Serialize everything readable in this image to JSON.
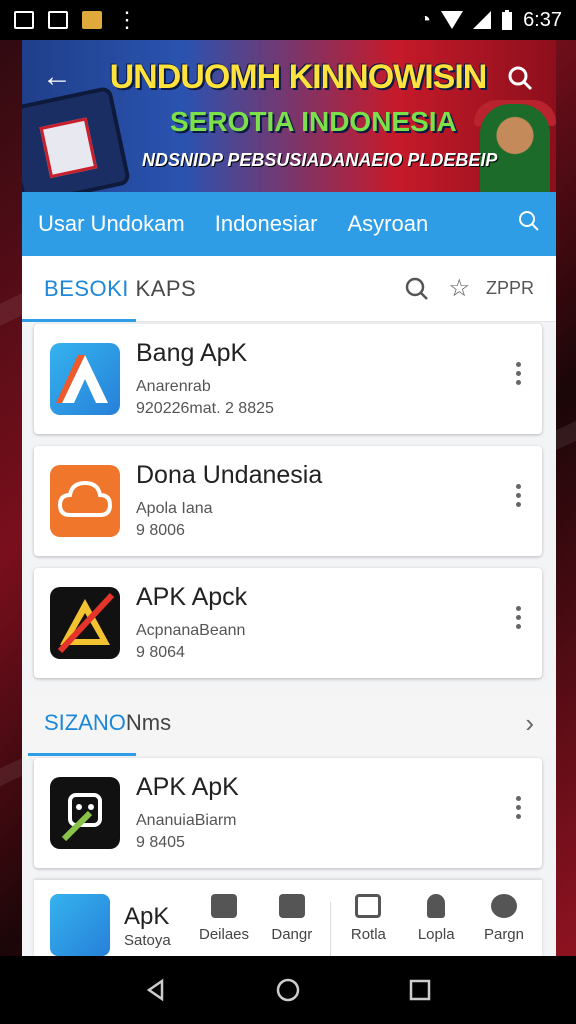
{
  "status_bar": {
    "time": "6:37",
    "icons": [
      "photo-icon",
      "gallery-icon",
      "app-icon",
      "more-vert-icon",
      "alarm-icon",
      "wifi-icon",
      "signal-icon",
      "battery-icon"
    ]
  },
  "banner": {
    "line1": "UNDUOMH KINNOWISIN",
    "line2": "SEROTIA INDONESIA",
    "line3": "NDSNIDP PEBSUSIADANAEIO PLDEBEIP",
    "back_icon": "arrow-back-icon",
    "search_icon": "search-icon"
  },
  "tabs": {
    "items": [
      "Usar Undokam",
      "Indonesiar",
      "Asyroan"
    ],
    "search_icon": "search-icon"
  },
  "section1": {
    "title_accent": "BESOKI",
    "title_rest": " KAPS",
    "action_text": "ZPPR",
    "colors": {
      "accent": "#2e9de6"
    }
  },
  "apps": [
    {
      "name": "Bang ApK",
      "line1": "Anarenrab",
      "line2": "920226mat. 2 8825"
    },
    {
      "name": "Dona Undanesia",
      "line1": "Apola Iana",
      "line2": "9 8006"
    },
    {
      "name": "APK Apck",
      "line1": "AcpnanaBeann",
      "line2": "9 8064"
    }
  ],
  "section2": {
    "title_accent": "SIZANO",
    "title_rest": "Nms"
  },
  "app4": {
    "name": "APK ApK",
    "line1": "AnanuiaBiarm",
    "line2": "9 8405"
  },
  "bottom_bar": {
    "promo_name": "ApK",
    "promo_sub": "Satoya",
    "nav": [
      "Deilaes",
      "Dangr",
      "Rotla",
      "Lopla",
      "Pargn"
    ]
  }
}
